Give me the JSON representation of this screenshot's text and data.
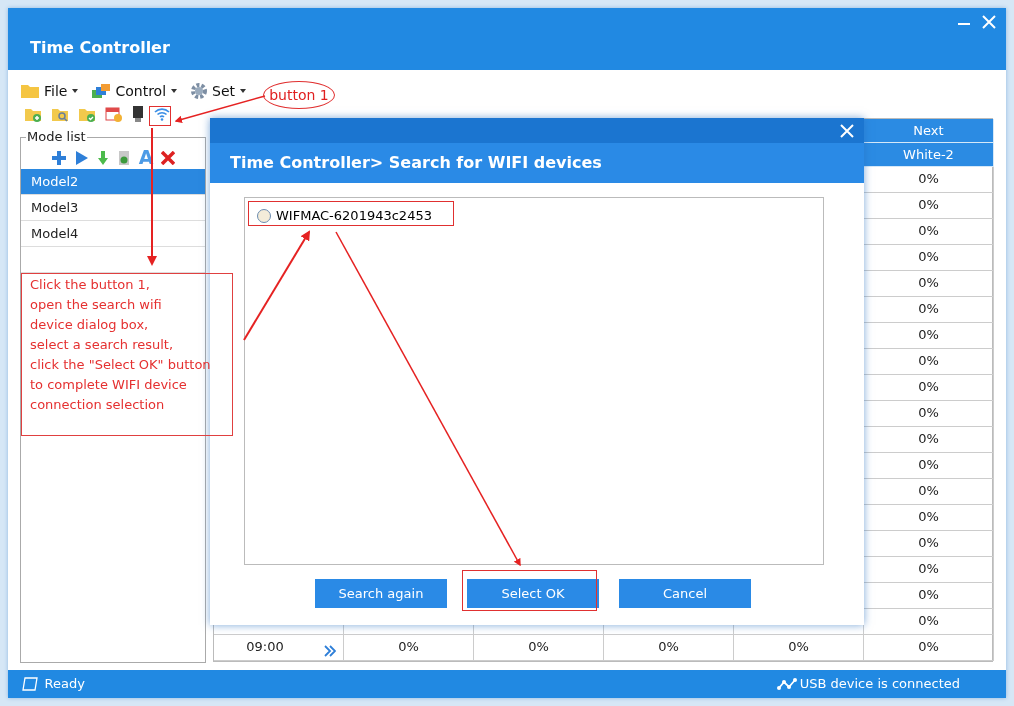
{
  "window": {
    "title": "Time Controller"
  },
  "menu": [
    {
      "label": "File"
    },
    {
      "label": "Control"
    },
    {
      "label": "Set"
    }
  ],
  "mode_list": {
    "title": "Mode list",
    "glyph": "A",
    "items": [
      {
        "label": "Model2",
        "selected": true
      },
      {
        "label": "Model3",
        "selected": false
      },
      {
        "label": "Model4",
        "selected": false
      }
    ]
  },
  "table": {
    "header": [
      "Next",
      "White-2"
    ],
    "rows": [
      {
        "next": "0%"
      },
      {
        "next": "0%"
      },
      {
        "next": "0%"
      },
      {
        "next": "0%"
      },
      {
        "next": "0%"
      },
      {
        "next": "0%"
      },
      {
        "next": "0%"
      },
      {
        "next": "0%"
      },
      {
        "next": "0%"
      },
      {
        "next": "0%"
      },
      {
        "next": "0%"
      },
      {
        "next": "0%"
      },
      {
        "next": "0%"
      },
      {
        "next": "0%"
      },
      {
        "next": "0%"
      },
      {
        "next": "0%"
      },
      {
        "next": "0%"
      },
      {
        "next": "0%"
      },
      {
        "time": "09:00",
        "values": [
          "0%",
          "0%",
          "0%",
          "0%",
          "0%"
        ]
      }
    ]
  },
  "dialog": {
    "title": "Time Controller> Search for WIFI devices",
    "results": [
      {
        "label": "WIFMAC-6201943c2453",
        "selected": false
      }
    ],
    "buttons": [
      "Search again",
      "Select OK",
      "Cancel"
    ]
  },
  "status_bar": {
    "left": "Ready",
    "right": "USB device is connected"
  },
  "annotations": {
    "callout": "button 1",
    "note": "Click the button 1,\nopen the search wifi\ndevice dialog box,\nselect a search result,\nclick the \"Select OK\" button\nto complete WIFI device\nconnection selection"
  }
}
